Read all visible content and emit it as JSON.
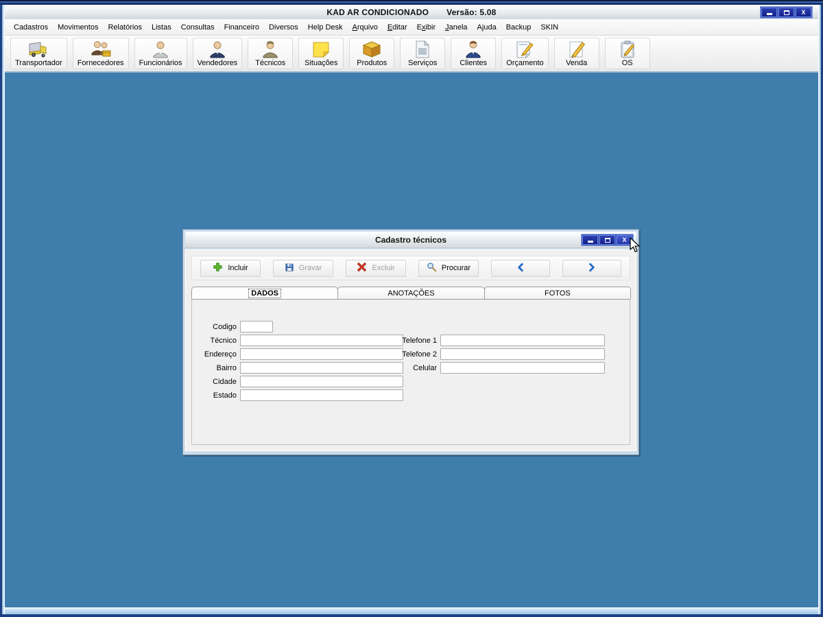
{
  "window": {
    "title": "KAD AR CONDICIONADO",
    "version": "Versão: 5.08",
    "controls": {
      "close": "X"
    }
  },
  "menu": {
    "items": [
      {
        "label": "Cadastros"
      },
      {
        "label": "Movimentos"
      },
      {
        "label": "Relatórios"
      },
      {
        "label": "Listas"
      },
      {
        "label": "Consultas"
      },
      {
        "label": "Financeiro"
      },
      {
        "label": "Diversos"
      },
      {
        "label": "Help Desk"
      },
      {
        "label": "Arquivo",
        "accel": 0
      },
      {
        "label": "Editar",
        "accel": 0
      },
      {
        "label": "Exibir",
        "accel": 1
      },
      {
        "label": "Janela",
        "accel": 0
      },
      {
        "label": "Ajuda"
      },
      {
        "label": "Backup"
      },
      {
        "label": "SKIN"
      }
    ]
  },
  "toolbar": {
    "buttons": [
      {
        "label": "Transportador",
        "icon": "truck-icon"
      },
      {
        "label": "Fornecedores",
        "icon": "suppliers-icon"
      },
      {
        "label": "Funcionários",
        "icon": "employee-icon"
      },
      {
        "label": "Vendedores",
        "icon": "seller-icon"
      },
      {
        "label": "Técnicos",
        "icon": "technician-icon"
      },
      {
        "label": "Situações",
        "icon": "sticky-note-icon"
      },
      {
        "label": "Produtos",
        "icon": "box-icon"
      },
      {
        "label": "Serviços",
        "icon": "document-icon"
      },
      {
        "label": "Clientes",
        "icon": "client-icon"
      },
      {
        "label": "Orçamento",
        "icon": "notepad-pencil-icon"
      },
      {
        "label": "Venda",
        "icon": "pencil-icon"
      },
      {
        "label": "OS",
        "icon": "clipboard-pencil-icon"
      }
    ]
  },
  "dialog": {
    "title": "Cadastro técnicos",
    "toolbar": {
      "incluir": {
        "label": "Incluir",
        "enabled": true
      },
      "gravar": {
        "label": "Gravar",
        "enabled": false
      },
      "excluir": {
        "label": "Excluir",
        "enabled": false
      },
      "procurar": {
        "label": "Procurar",
        "enabled": true
      }
    },
    "tabs": [
      {
        "label": "DADOS",
        "active": true
      },
      {
        "label": "ANOTAÇÕES",
        "active": false
      },
      {
        "label": "FOTOS",
        "active": false
      }
    ],
    "form": {
      "fields_left": [
        {
          "label": "Codigo",
          "value": ""
        },
        {
          "label": "Técnico",
          "value": ""
        },
        {
          "label": "Endereço",
          "value": ""
        },
        {
          "label": "Bairro",
          "value": ""
        },
        {
          "label": "Cidade",
          "value": ""
        },
        {
          "label": "Estado",
          "value": ""
        }
      ],
      "fields_right": [
        {
          "label": "Telefone 1",
          "value": ""
        },
        {
          "label": "Telefone 2",
          "value": ""
        },
        {
          "label": "Celular",
          "value": ""
        }
      ]
    }
  },
  "colors": {
    "mdi_background": "#3e7dac",
    "frame_navy": "#1d4084",
    "frame_lightblue": "#9cc4e0",
    "control_button_blue": "#1c2f9e",
    "accent_blue": "#2a6fc9",
    "disabled_text": "#a0a0a0",
    "status_green_plus": "#5cb830",
    "delete_red": "#cc2222"
  }
}
